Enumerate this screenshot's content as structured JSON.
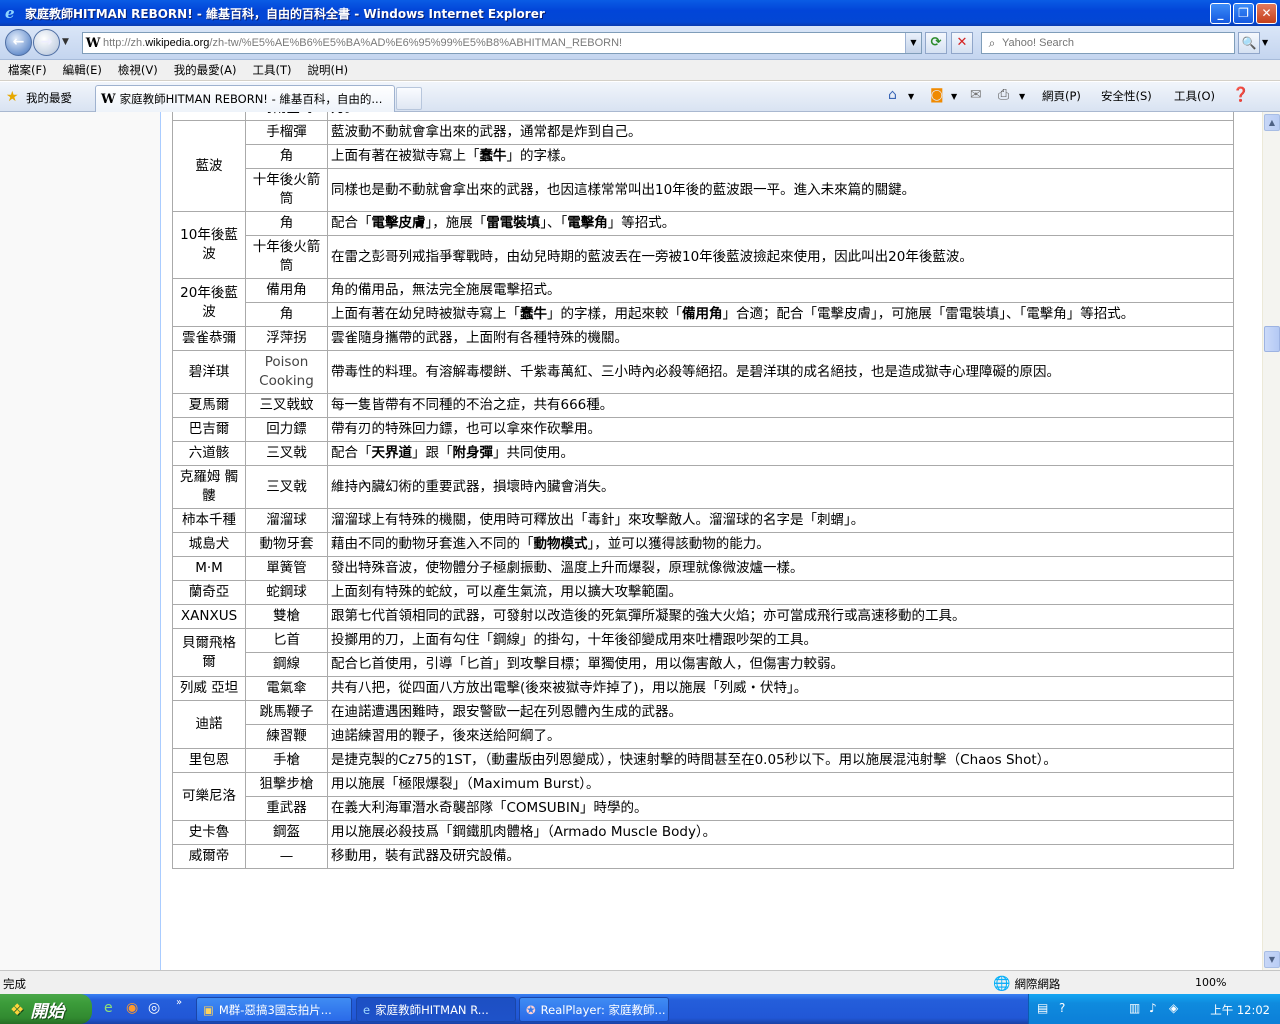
{
  "window": {
    "title": "家庭教師HITMAN REBORN! - 維基百科，自由的百科全書 - Windows Internet Explorer"
  },
  "address": {
    "url_prefix": "http://zh.",
    "url_domain": "wikipedia.org",
    "url_rest": "/zh-tw/%E5%AE%B6%E5%BA%AD%E6%95%99%E5%B8%ABHITMAN_REBORN!",
    "search_placeholder": "Yahoo! Search"
  },
  "menu": [
    "檔案(F)",
    "編輯(E)",
    "檢視(V)",
    "我的最愛(A)",
    "工具(T)",
    "說明(H)"
  ],
  "tabs": {
    "favorites_label": "我的最愛",
    "active_tab_title": "家庭教師HITMAN REBORN! - 維基百科，自由的..."
  },
  "commands": {
    "page": "網頁(P)",
    "safety": "安全性(S)",
    "tools": "工具(O)"
  },
  "table": {
    "rows": [
      {
        "who": "",
        "weapon": "時雨金時",
        "desc": "刀。",
        "desc_html": false
      },
      {
        "who": "藍波",
        "rowspan": 3,
        "weapon": "手榴彈",
        "desc": "藍波動不動就會拿出來的武器，通常都是炸到自己。"
      },
      {
        "weapon": "角",
        "desc_parts": [
          "上面有著在被獄寺寫上「",
          "蠢牛",
          "」的字樣。"
        ]
      },
      {
        "weapon": "十年後火箭筒",
        "desc": "同樣也是動不動就會拿出來的武器，也因這樣常常叫出10年後的藍波跟一平。進入未來篇的關鍵。",
        "tall": true
      },
      {
        "who": "10年後藍波",
        "rowspan": 2,
        "weapon": "角",
        "desc_parts": [
          "配合「",
          "電擊皮膚",
          "」，施展「",
          "雷電裝填",
          "」、「",
          "電擊角",
          "」等招式。"
        ]
      },
      {
        "weapon": "十年後火箭筒",
        "desc": "在雷之彭哥列戒指爭奪戰時，由幼兒時期的藍波丟在一旁被10年後藍波撿起來使用，因此叫出20年後藍波。",
        "tall": true
      },
      {
        "who": "20年後藍波",
        "rowspan": 2,
        "weapon": "備用角",
        "desc": "角的備用品，無法完全施展電擊招式。"
      },
      {
        "weapon": "角",
        "desc_parts": [
          "上面有著在幼兒時被獄寺寫上「",
          "蠢牛",
          "」的字樣，用起來較「",
          "備用角",
          "」合適；配合「電擊皮膚」，可施展「雷電裝填」、「電擊角」等招式。"
        ],
        "tall": true
      },
      {
        "who": "雲雀恭彌",
        "weapon": "浮萍拐",
        "desc": "雲雀隨身攜帶的武器，上面附有各種特殊的機關。"
      },
      {
        "who": "碧洋琪",
        "weapon": "Poison Cooking",
        "weapon_gray": true,
        "desc": "帶毒性的料理。有溶解毒櫻餅、千紫毒萬紅、三小時內必殺等絕招。是碧洋琪的成名絕技，也是造成獄寺心理障礙的原因。",
        "tall": true
      },
      {
        "who": "夏馬爾",
        "weapon": "三叉戟蚊",
        "desc": "每一隻皆帶有不同種的不治之症，共有666種。"
      },
      {
        "who": "巴吉爾",
        "weapon": "回力鏢",
        "desc": "帶有刃的特殊回力鏢，也可以拿來作砍擊用。"
      },
      {
        "who": "六道骸",
        "weapon": "三叉戟",
        "desc_parts": [
          "配合「",
          "天界道",
          "」跟「",
          "附身彈",
          "」共同使用。"
        ]
      },
      {
        "who": "克羅姆 髑髏",
        "weapon": "三叉戟",
        "desc": "維持內臟幻術的重要武器，損壞時內臟會消失。",
        "tall": true
      },
      {
        "who": "柿本千種",
        "weapon": "溜溜球",
        "desc": "溜溜球上有特殊的機關，使用時可釋放出「毒針」來攻擊敵人。溜溜球的名字是「刺蝟」。"
      },
      {
        "who": "城島犬",
        "weapon": "動物牙套",
        "desc_parts": [
          "藉由不同的動物牙套進入不同的「",
          "動物模式",
          "」，並可以獲得該動物的能力。"
        ]
      },
      {
        "who": "M·M",
        "weapon": "單簧管",
        "desc": "發出特殊音波，使物體分子極劇振動、溫度上升而爆裂，原理就像微波爐一樣。"
      },
      {
        "who": "蘭奇亞",
        "weapon": "蛇鋼球",
        "desc": "上面刻有特殊的蛇紋，可以產生氣流，用以擴大攻擊範圍。"
      },
      {
        "who": "XANXUS",
        "weapon": "雙槍",
        "desc": "跟第七代首領相同的武器，可發射以改造後的死氣彈所凝聚的強大火焰；亦可當成飛行或高速移動的工具。"
      },
      {
        "who": "貝爾飛格爾",
        "rowspan": 2,
        "weapon": "匕首",
        "desc": "投擲用的刀，上面有勾住「鋼線」的掛勾，十年後卻變成用來吐槽跟吵架的工具。"
      },
      {
        "weapon": "鋼線",
        "desc": "配合匕首使用，引導「匕首」到攻擊目標；單獨使用，用以傷害敵人，但傷害力較弱。"
      },
      {
        "who": "列威 亞坦",
        "weapon": "電氣傘",
        "desc": "共有八把，從四面八方放出電擊(後來被獄寺炸掉了)，用以施展「列威・伏特」。",
        "tall": true
      },
      {
        "who": "迪諾",
        "rowspan": 2,
        "weapon": "跳馬鞭子",
        "desc": "在迪諾遭遇困難時，跟安警歐一起在列恩體內生成的武器。"
      },
      {
        "weapon": "練習鞭",
        "desc": "迪諾練習用的鞭子，後來送給阿綱了。"
      },
      {
        "who": "里包恩",
        "weapon": "手槍",
        "desc": "是捷克製的Cz75的1ST，（動畫版由列恩變成），快速射擊的時間甚至在0.05秒以下。用以施展混沌射擊（Chaos Shot）。"
      },
      {
        "who": "可樂尼洛",
        "rowspan": 2,
        "weapon": "狙擊步槍",
        "desc": "用以施展「極限爆裂」（Maximum Burst）。"
      },
      {
        "weapon": "重武器",
        "desc": "在義大利海軍潛水奇襲部隊「COMSUBIN」時學的。"
      },
      {
        "who": "史卡魯",
        "weapon": "鋼盔",
        "desc": "用以施展必殺技爲「鋼鐵肌肉體格」（Armado Muscle Body）。"
      },
      {
        "who": "威爾帝",
        "weapon": "—",
        "desc": "移動用，裝有武器及研究設備。"
      }
    ]
  },
  "status": {
    "text": "完成",
    "zone": "網際網路",
    "zoom": "100%"
  },
  "taskbar": {
    "start_label": "開始",
    "tasks": [
      "M群-惡搞3國志拍片...",
      "家庭教師HITMAN R...",
      "RealPlayer: 家庭教師..."
    ],
    "clock": "上午 12:02"
  }
}
